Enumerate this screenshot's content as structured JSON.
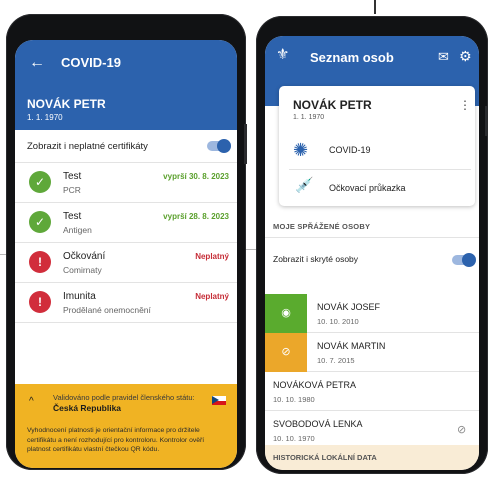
{
  "left": {
    "header": {
      "back_icon": "←",
      "title": "COVID-19",
      "name": "NOVÁK PETR",
      "dob": "1. 1. 1970"
    },
    "toggle_label": "Zobrazit i neplatné certifikáty",
    "certificates": [
      {
        "title": "Test",
        "subtitle": "PCR",
        "status": "vyprší 30. 8. 2023",
        "icon": "check-icon"
      },
      {
        "title": "Test",
        "subtitle": "Antigen",
        "status": "vyprší 28. 8. 2023",
        "icon": "check-icon"
      },
      {
        "title": "Očkování",
        "subtitle": "Comirnaty",
        "status": "Neplatný",
        "icon": "warning-icon"
      },
      {
        "title": "Imunita",
        "subtitle": "Prodělané onemocnění",
        "status": "Neplatný",
        "icon": "warning-icon"
      }
    ],
    "footer": {
      "chevron": "^",
      "validation_rule": "Validováno podle pravidel členského státu:",
      "country": "Česká Republika",
      "note": "Vyhodnocení platnosti je orientační informace pro držitele certifikátu a není rozhodující pro kontroloru. Kontrolor ověří platnost certifikátu vlastní čtečkou QR kódu."
    }
  },
  "right": {
    "header": {
      "title": "Seznam osob",
      "lion_icon": "⚜",
      "mail_icon": "✉",
      "gear_icon": "⚙"
    },
    "card": {
      "name": "NOVÁK PETR",
      "dob": "1. 1. 1970",
      "more_icon": "⋮",
      "covid_icon": "✺",
      "covid_label": "COVID-19",
      "vaccine_icon": "💉",
      "vaccine_label": "Očkovací průkazka"
    },
    "linked_section": "MOJE SPŘÁŽENÉ OSOBY",
    "toggle_label": "Zobrazit i skryté osoby",
    "persons": [
      {
        "name": "NOVÁK JOSEF",
        "dob": "10. 10. 2010",
        "tag_icon": "◉"
      },
      {
        "name": "NOVÁK MARTIN",
        "dob": "10. 7. 2015",
        "tag_icon": "⊘"
      },
      {
        "name": "NOVÁKOVÁ PETRA",
        "dob": "10. 10. 1980"
      },
      {
        "name": "SVOBODOVÁ LENKA",
        "dob": "10. 10. 1970",
        "eye_icon": "⊘"
      }
    ],
    "history_section": "HISTORICKÁ LOKÁLNÍ DATA"
  }
}
